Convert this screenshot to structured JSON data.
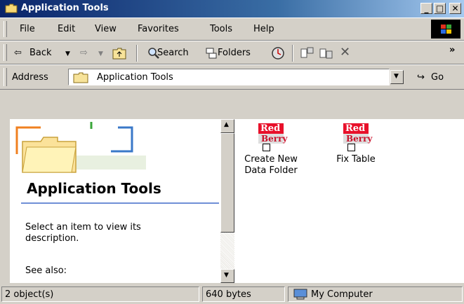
{
  "window": {
    "title": "Application Tools",
    "controls": {
      "minimize": "_",
      "maximize": "□",
      "close": "✕"
    }
  },
  "menu": [
    "File",
    "Edit",
    "View",
    "Favorites",
    "Tools",
    "Help"
  ],
  "toolbar": {
    "back": "Back",
    "search": "Search",
    "folders": "Folders",
    "more": "»"
  },
  "address": {
    "label": "Address",
    "value": "Application Tools",
    "go": "Go"
  },
  "left_pane": {
    "title": "Application Tools",
    "description": "Select an item to view its description.",
    "see_also": "See also:"
  },
  "files": [
    {
      "name": "Create New Data Folder",
      "logo_top": "Red",
      "logo_bottom": "Berry"
    },
    {
      "name": "Fix Table",
      "logo_top": "Red",
      "logo_bottom": "Berry"
    }
  ],
  "status": {
    "objects": "2 object(s)",
    "size": "640 bytes",
    "zone": "My Computer"
  },
  "colors": {
    "titlebar_start": "#0a246a",
    "titlebar_end": "#a6caf0",
    "logo_red": "#e8102a",
    "chrome": "#d4d0c8"
  }
}
